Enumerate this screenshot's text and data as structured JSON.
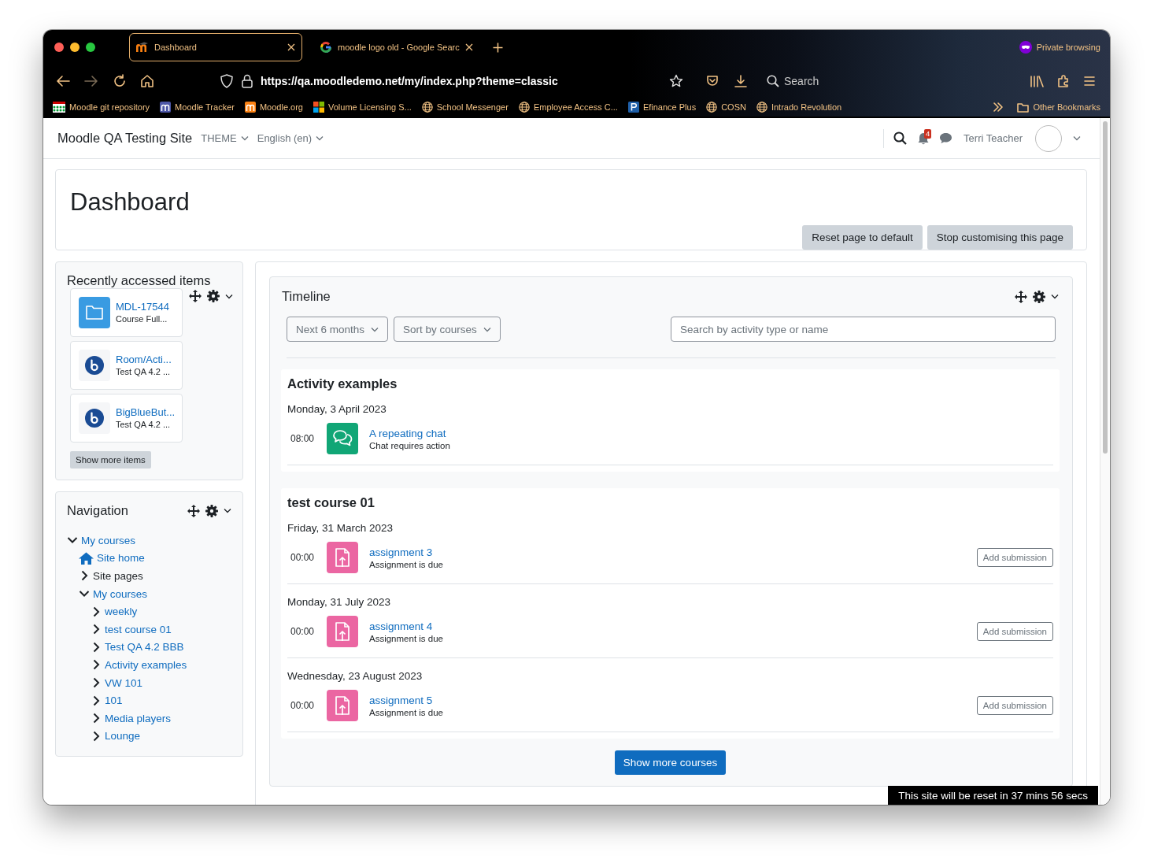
{
  "browser": {
    "tabs": [
      {
        "title": "Dashboard",
        "selected": true,
        "kind": "moodle"
      },
      {
        "title": "moodle logo old - Google Searc",
        "selected": false,
        "kind": "google"
      }
    ],
    "private_label": "Private browsing",
    "url": "https://qa.moodledemo.net/my/index.php?theme=classic",
    "search_label": "Search",
    "bookmarks": [
      {
        "label": "Moodle git repository",
        "kind": "git"
      },
      {
        "label": "Moodle Tracker",
        "kind": "tracker"
      },
      {
        "label": "Moodle.org",
        "kind": "moodle"
      },
      {
        "label": "Volume Licensing S...",
        "kind": "windows"
      },
      {
        "label": "School Messenger",
        "kind": "globe"
      },
      {
        "label": "Employee Access C...",
        "kind": "globe"
      },
      {
        "label": "Efinance Plus",
        "kind": "efinance"
      },
      {
        "label": "COSN",
        "kind": "globe"
      },
      {
        "label": "Intrado Revolution",
        "kind": "globe"
      }
    ],
    "other_bookmarks": "Other Bookmarks"
  },
  "navbar": {
    "site_name": "Moodle QA Testing Site",
    "menus": [
      "THEME",
      "English (en)"
    ],
    "notification_count": "4",
    "user_name": "Terri Teacher"
  },
  "page_header": {
    "title": "Dashboard",
    "buttons": [
      "Reset page to default",
      "Stop customising this page"
    ]
  },
  "recent_items": {
    "title": "Recently accessed items",
    "items": [
      {
        "name": "MDL-17544",
        "subtitle": "Course Full...",
        "kind": "folder"
      },
      {
        "name": "Room/Acti...",
        "subtitle": "Test QA 4.2 ...",
        "kind": "bbb"
      },
      {
        "name": "BigBlueBut...",
        "subtitle": "Test QA 4.2 ...",
        "kind": "bbb"
      }
    ],
    "show_more": "Show more items"
  },
  "navigation": {
    "title": "Navigation",
    "tree": [
      {
        "label": "My courses",
        "kind": "branch",
        "expanded": true,
        "link": true,
        "children": [
          {
            "label": "Site home",
            "kind": "home",
            "link": true
          },
          {
            "label": "Site pages",
            "kind": "branch",
            "expanded": false,
            "link": false
          },
          {
            "label": "My courses",
            "kind": "branch",
            "expanded": true,
            "link": true,
            "children": [
              {
                "label": "weekly",
                "kind": "branch",
                "expanded": false,
                "link": true
              },
              {
                "label": "test course 01",
                "kind": "branch",
                "expanded": false,
                "link": true
              },
              {
                "label": "Test QA 4.2 BBB",
                "kind": "branch",
                "expanded": false,
                "link": true
              },
              {
                "label": "Activity examples",
                "kind": "branch",
                "expanded": false,
                "link": true
              },
              {
                "label": "VW 101",
                "kind": "branch",
                "expanded": false,
                "link": true
              },
              {
                "label": "101",
                "kind": "branch",
                "expanded": false,
                "link": true
              },
              {
                "label": "Media players",
                "kind": "branch",
                "expanded": false,
                "link": true
              },
              {
                "label": "Lounge",
                "kind": "branch",
                "expanded": false,
                "link": true
              }
            ]
          }
        ]
      }
    ]
  },
  "timeline": {
    "title": "Timeline",
    "filters": [
      "Next 6 months",
      "Sort by courses"
    ],
    "search": {
      "placeholder": "Search by activity type or name"
    },
    "courses": [
      {
        "name": "Activity examples",
        "days": [
          {
            "date": "Monday, 3 April 2023",
            "events": [
              {
                "time": "08:00",
                "title": "A repeating chat",
                "subtitle": "Chat requires action",
                "kind": "chat"
              }
            ]
          }
        ]
      },
      {
        "name": "test course 01",
        "days": [
          {
            "date": "Friday, 31 March 2023",
            "events": [
              {
                "time": "00:00",
                "title": "assignment 3",
                "subtitle": "Assignment is due",
                "kind": "assignment",
                "action": "Add submission"
              }
            ]
          },
          {
            "date": "Monday, 31 July 2023",
            "events": [
              {
                "time": "00:00",
                "title": "assignment 4",
                "subtitle": "Assignment is due",
                "kind": "assignment",
                "action": "Add submission"
              }
            ]
          },
          {
            "date": "Wednesday, 23 August 2023",
            "events": [
              {
                "time": "00:00",
                "title": "assignment 5",
                "subtitle": "Assignment is due",
                "kind": "assignment",
                "action": "Add submission"
              }
            ]
          }
        ]
      }
    ],
    "show_more": "Show more courses"
  },
  "reset_notice": "This site will be reset in 37 mins 56 secs"
}
